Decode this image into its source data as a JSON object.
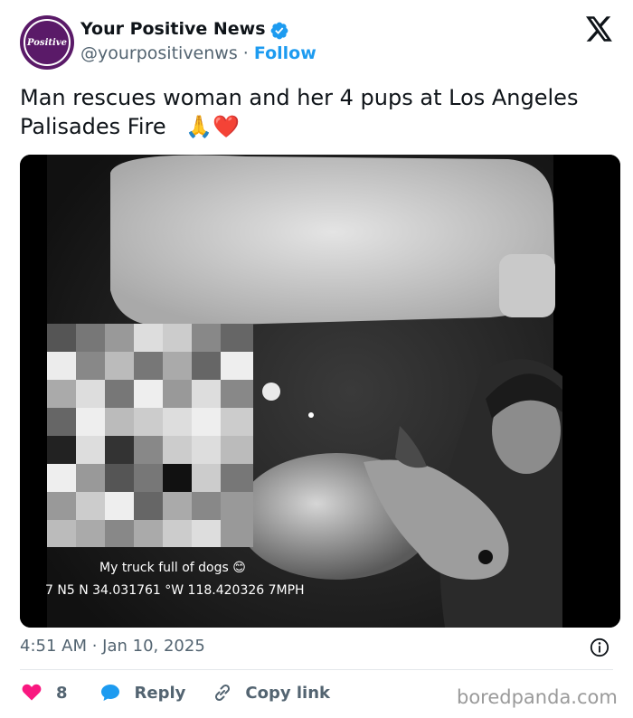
{
  "account": {
    "avatar_text": "Positive",
    "name": "Your Positive News",
    "handle": "@yourpositivenws",
    "separator": "·",
    "follow_label": "Follow"
  },
  "tweet": {
    "text": "Man rescues woman and her 4 pups at Los Angeles Palisades Fire",
    "emoji": "🙏❤️"
  },
  "media": {
    "caption": "My truck full of dogs 😊",
    "overlay_text": "7  N5   N 34.031761 °W 118.420326   7MPH"
  },
  "meta": {
    "timestamp": "4:51 AM · Jan 10, 2025"
  },
  "actions": {
    "like_count": "8",
    "reply_label": "Reply",
    "copy_link_label": "Copy link"
  },
  "watermark": "boredpanda.com",
  "colors": {
    "accent_blue": "#1d9bf0",
    "heart_pink": "#f91880",
    "avatar_purple": "#5a1a68",
    "secondary_text": "#536471"
  }
}
